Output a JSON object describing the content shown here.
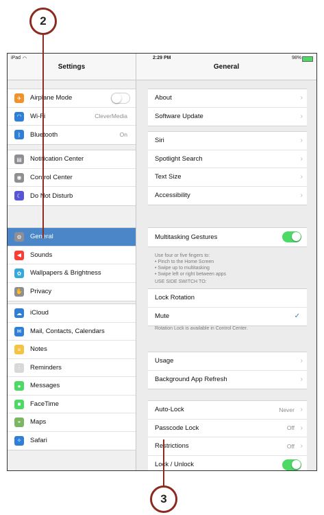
{
  "callouts": {
    "top": "2",
    "bottom": "3"
  },
  "status": {
    "carrier": "iPad",
    "time": "2:29 PM",
    "battery": "98%"
  },
  "left_title": "Settings",
  "right_title": "General",
  "left_groups": [
    [
      {
        "label": "Airplane Mode",
        "icon": "airplane-icon",
        "icon_char": "✈",
        "color": "#f0932b",
        "toggle": "off"
      },
      {
        "label": "Wi-Fi",
        "icon": "wifi-icon",
        "icon_char": "◠",
        "color": "#2f7fd8",
        "value": "CleverMedia"
      },
      {
        "label": "Bluetooth",
        "icon": "bluetooth-icon",
        "icon_char": "ᛒ",
        "color": "#2f7fd8",
        "value": "On"
      }
    ],
    [
      {
        "label": "Notification Center",
        "icon": "notification-center-icon",
        "icon_char": "▤",
        "color": "#8e8e93"
      },
      {
        "label": "Control Center",
        "icon": "control-center-icon",
        "icon_char": "◉",
        "color": "#8e8e93"
      },
      {
        "label": "Do Not Disturb",
        "icon": "moon-icon",
        "icon_char": "☾",
        "color": "#5856d6"
      }
    ],
    [
      {
        "label": "General",
        "icon": "gear-icon",
        "icon_char": "⚙",
        "color": "#8e8e93",
        "selected": true
      },
      {
        "label": "Sounds",
        "icon": "speaker-icon",
        "icon_char": "◀",
        "color": "#ff3b30"
      },
      {
        "label": "Wallpapers & Brightness",
        "icon": "wallpaper-icon",
        "icon_char": "✿",
        "color": "#34aadc"
      },
      {
        "label": "Privacy",
        "icon": "hand-icon",
        "icon_char": "✋",
        "color": "#8e8e93"
      }
    ],
    [
      {
        "label": "iCloud",
        "icon": "cloud-icon",
        "icon_char": "☁",
        "color": "#2f7fd8"
      },
      {
        "label": "Mail, Contacts, Calendars",
        "icon": "mail-icon",
        "icon_char": "✉",
        "color": "#2f7fd8"
      },
      {
        "label": "Notes",
        "icon": "notes-icon",
        "icon_char": "≡",
        "color": "#f5c242"
      },
      {
        "label": "Reminders",
        "icon": "reminders-icon",
        "icon_char": "⋮",
        "color": "#d8d8d8"
      },
      {
        "label": "Messages",
        "icon": "messages-icon",
        "icon_char": "●",
        "color": "#4cd964"
      },
      {
        "label": "FaceTime",
        "icon": "video-camera-icon",
        "icon_char": "■",
        "color": "#4cd964"
      },
      {
        "label": "Maps",
        "icon": "map-icon",
        "icon_char": "⌖",
        "color": "#7bb661"
      },
      {
        "label": "Safari",
        "icon": "compass-icon",
        "icon_char": "✧",
        "color": "#2f7fd8"
      }
    ]
  ],
  "right_groups": [
    [
      {
        "label": "About",
        "chevron": true
      },
      {
        "label": "Software Update",
        "chevron": true
      }
    ],
    [
      {
        "label": "Siri",
        "chevron": true
      },
      {
        "label": "Spotlight Search",
        "chevron": true
      },
      {
        "label": "Text Size",
        "chevron": true
      },
      {
        "label": "Accessibility",
        "chevron": true
      }
    ],
    [
      {
        "label": "Multitasking Gestures",
        "toggle": "on"
      }
    ],
    [
      {
        "label": "Lock Rotation"
      },
      {
        "label": "Mute",
        "check": true
      }
    ],
    [
      {
        "label": "Usage",
        "chevron": true
      },
      {
        "label": "Background App Refresh",
        "chevron": true
      }
    ],
    [
      {
        "label": "Auto-Lock",
        "value": "Never",
        "chevron": true
      },
      {
        "label": "Passcode Lock",
        "value": "Off",
        "chevron": true
      },
      {
        "label": "Restrictions",
        "value": "Off",
        "chevron": true
      },
      {
        "label": "Lock / Unlock",
        "toggle": "on"
      }
    ]
  ],
  "multitask_note": [
    "Use four or five fingers to:",
    "• Pinch to the Home Screen",
    "• Swipe up to multitasking",
    "• Swipe left or right between apps"
  ],
  "side_switch_header": "USE SIDE SWITCH TO:",
  "rotation_note": "Rotation Lock is available in Control Center.",
  "colors": {
    "selected": "#4a86c8",
    "toggle_on": "#4cd964",
    "callout_ring": "#8b2a1f"
  }
}
